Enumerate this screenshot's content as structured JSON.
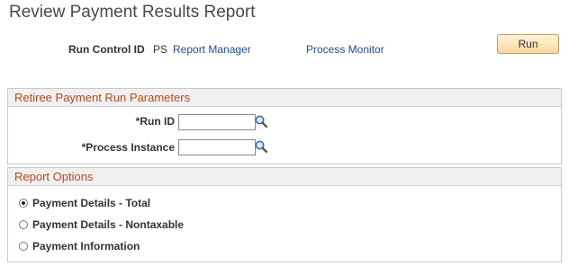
{
  "page": {
    "title": "Review Payment Results Report"
  },
  "run_control": {
    "label": "Run Control ID",
    "value": "PS",
    "report_manager": "Report Manager",
    "process_monitor": "Process Monitor",
    "run_button": "Run"
  },
  "parameters": {
    "header": "Retiree Payment Run Parameters",
    "run_id_label": "*Run ID",
    "run_id_value": "",
    "process_instance_label": "*Process Instance",
    "process_instance_value": ""
  },
  "report_options": {
    "header": "Report Options",
    "options": [
      {
        "label": "Payment Details - Total",
        "selected": true
      },
      {
        "label": "Payment Details - Nontaxable",
        "selected": false
      },
      {
        "label": "Payment Information",
        "selected": false
      }
    ]
  },
  "colors": {
    "accent": "#b1481e",
    "link": "#1f4b8f",
    "button": "#f8d9a3"
  },
  "icons": {
    "lookup": "magnifier-icon"
  }
}
